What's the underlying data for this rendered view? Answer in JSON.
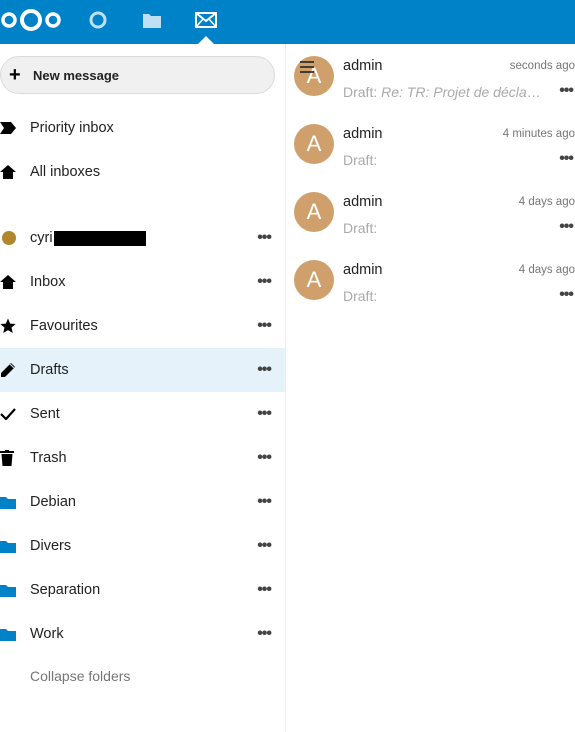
{
  "header": {
    "apps": [
      "dashboard",
      "files",
      "mail"
    ],
    "active_app": "mail",
    "brand_color": "#0082c9"
  },
  "sidebar": {
    "new_message": "New message",
    "top_items": [
      {
        "label": "Priority inbox",
        "icon": "priority-icon"
      },
      {
        "label": "All inboxes",
        "icon": "home-icon"
      }
    ],
    "account": {
      "label": "cyri",
      "color": "#b2862a"
    },
    "folders": [
      {
        "label": "Inbox",
        "icon": "home-icon"
      },
      {
        "label": "Favourites",
        "icon": "star-icon"
      },
      {
        "label": "Drafts",
        "icon": "pencil-icon",
        "active": true
      },
      {
        "label": "Sent",
        "icon": "check-icon"
      },
      {
        "label": "Trash",
        "icon": "trash-icon"
      },
      {
        "label": "Debian",
        "icon": "folder-icon"
      },
      {
        "label": "Divers",
        "icon": "folder-icon"
      },
      {
        "label": "Separation",
        "icon": "folder-icon"
      },
      {
        "label": "Work",
        "icon": "folder-icon"
      }
    ],
    "collapse": "Collapse folders",
    "more": "•••"
  },
  "messages": [
    {
      "initial": "A",
      "sender": "admin",
      "time": "seconds ago",
      "prefix": "Draft:",
      "subject": "Re: TR: Projet de déclar…"
    },
    {
      "initial": "A",
      "sender": "admin",
      "time": "4 minutes ago",
      "prefix": "Draft:",
      "subject": ""
    },
    {
      "initial": "A",
      "sender": "admin",
      "time": "4 days ago",
      "prefix": "Draft:",
      "subject": ""
    },
    {
      "initial": "A",
      "sender": "admin",
      "time": "4 days ago",
      "prefix": "Draft:",
      "subject": ""
    }
  ],
  "colors": {
    "avatar": "#d0a06c",
    "active_row": "#e6f2fa",
    "folder": "#0082c9"
  }
}
